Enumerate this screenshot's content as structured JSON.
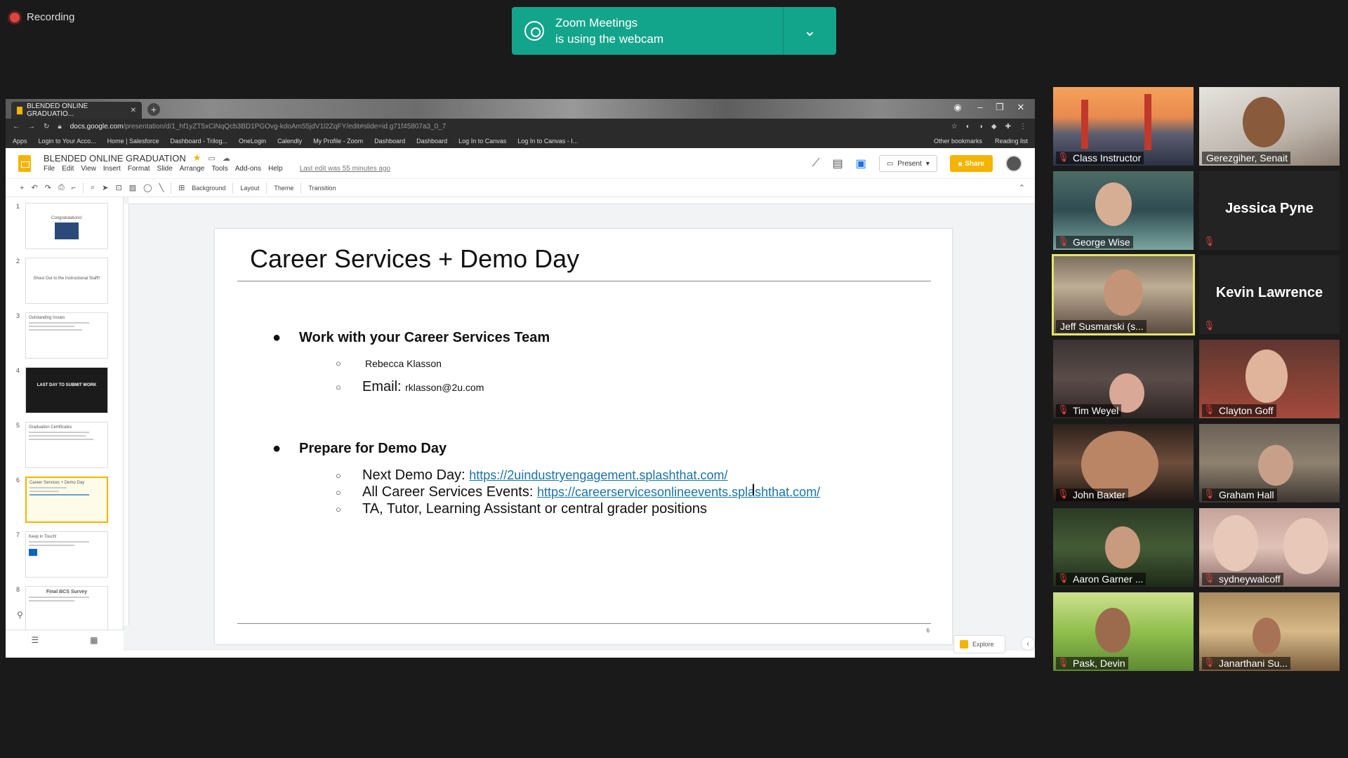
{
  "recording": {
    "label": "Recording"
  },
  "banner": {
    "line1": "Zoom Meetings",
    "line2": "is using the webcam",
    "chevron": "⌄"
  },
  "browser": {
    "tab_title": "BLENDED ONLINE GRADUATIO...",
    "url_domain": "docs.google.com",
    "url_path": "/presentation/d/1_hf1yZT5xCiNqQcb3BD1PGOvg-kdoAm55jdV1l2ZqFY/edit#slide=id.g71f45807a3_0_7",
    "bookmarks": [
      "Apps",
      "Login to Your Acco...",
      "Home | Salesforce",
      "Dashboard - Trilog...",
      "OneLogin",
      "Calendly",
      "My Profile - Zoom",
      "Dashboard",
      "Dashboard",
      "Log In to Canvas",
      "Log In to Canvas - I..."
    ],
    "bookmarks_right": [
      "Other bookmarks",
      "Reading list"
    ]
  },
  "slides_app": {
    "doc_title": "BLENDED ONLINE GRADUATION",
    "menu": [
      "File",
      "Edit",
      "View",
      "Insert",
      "Format",
      "Slide",
      "Arrange",
      "Tools",
      "Add-ons",
      "Help"
    ],
    "last_edit": "Last edit was 55 minutes ago",
    "present_label": "Present",
    "share_label": "Share",
    "toolbar": {
      "background": "Background",
      "layout": "Layout",
      "theme": "Theme",
      "transition": "Transition"
    },
    "explore_label": "Explore"
  },
  "filmstrip": {
    "thumbs": [
      {
        "num": "1",
        "text": "Congratulations!"
      },
      {
        "num": "2",
        "text": "Shout Out to the Instructional Staff!!"
      },
      {
        "num": "3",
        "text": "Outstanding Issues"
      },
      {
        "num": "4",
        "text": "LAST DAY TO SUBMIT WORK"
      },
      {
        "num": "5",
        "text": "Graduation Certificates"
      },
      {
        "num": "6",
        "text": "Career Services + Demo Day"
      },
      {
        "num": "7",
        "text": "Keep in Touch!"
      },
      {
        "num": "8",
        "text": "Final BCS Survey"
      }
    ]
  },
  "slide": {
    "title": "Career Services + Demo Day",
    "number": "6",
    "bullet1": "Work with your Career Services Team",
    "sub1": "Rebecca Klasson",
    "sub2_label": "Email: ",
    "sub2_value": "rklasson@2u.com",
    "bullet2": "Prepare for Demo Day",
    "sub3_label": "Next Demo Day: ",
    "sub3_link": "https://2uindustryengagement.splashthat.com/",
    "sub4_label": "All Career Services Events: ",
    "sub4_link": "https://careerservicesonlineevents.splashthat.com/",
    "sub5": "TA, Tutor, Learning Assistant or central grader positions",
    "bullet_dot": "●",
    "sub_circle": "○"
  },
  "participants": [
    {
      "name": "Class Instructor",
      "video": true,
      "muted": true
    },
    {
      "name": "Gerezgiher, Senait",
      "video": true,
      "muted": false
    },
    {
      "name": "George Wise",
      "video": true,
      "muted": true
    },
    {
      "name": "Jessica Pyne",
      "video": false,
      "muted": true
    },
    {
      "name": "Jeff Susmarski (s...",
      "video": true,
      "muted": false,
      "active": true
    },
    {
      "name": "Kevin Lawrence",
      "video": false,
      "muted": true
    },
    {
      "name": "Tim Weyel",
      "video": true,
      "muted": true
    },
    {
      "name": "Clayton Goff",
      "video": true,
      "muted": true
    },
    {
      "name": "John Baxter",
      "video": true,
      "muted": true
    },
    {
      "name": "Graham Hall",
      "video": true,
      "muted": true
    },
    {
      "name": "Aaron Garner ...",
      "video": true,
      "muted": true
    },
    {
      "name": "sydneywalcoff",
      "video": true,
      "muted": true
    },
    {
      "name": "Pask, Devin",
      "video": true,
      "muted": true
    },
    {
      "name": "Janarthani Su...",
      "video": true,
      "muted": true
    }
  ]
}
